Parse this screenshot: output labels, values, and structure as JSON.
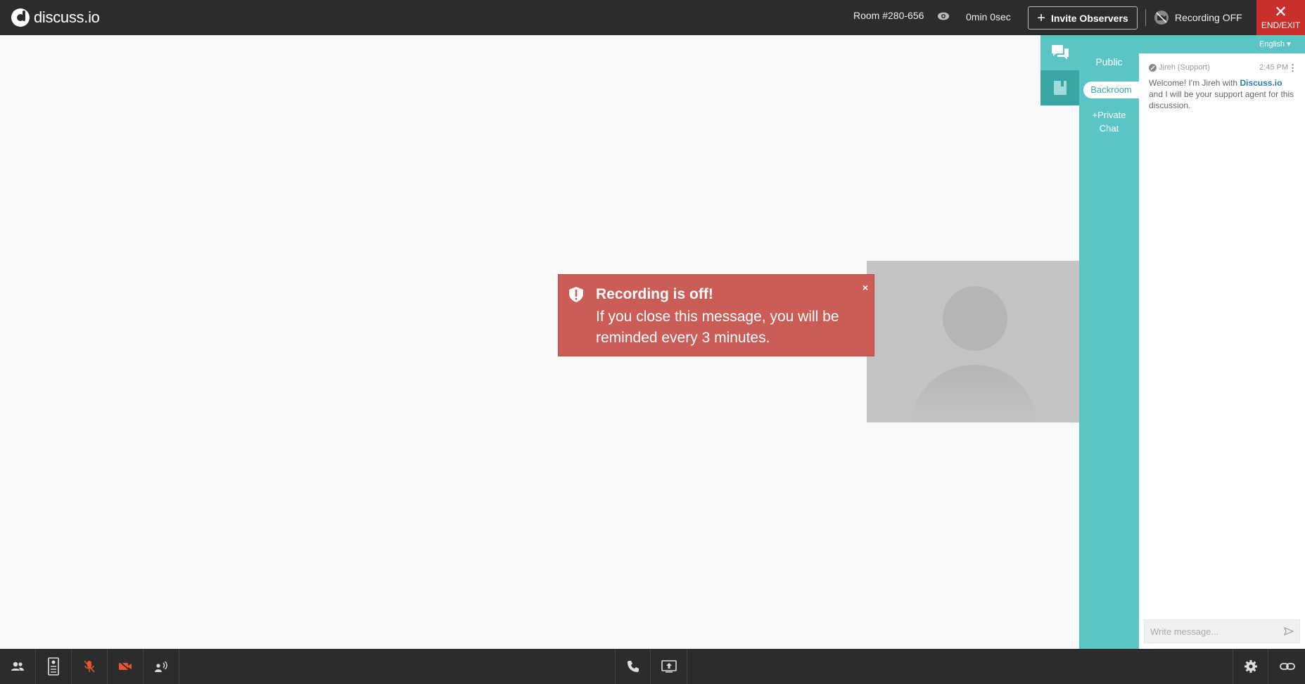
{
  "app": {
    "logo_text": "discuss.io"
  },
  "header": {
    "room": "Room #280-656",
    "timer": "0min 0sec",
    "invite_label": "Invite Observers",
    "recording_status": "Recording OFF",
    "end_label": "END/EXIT"
  },
  "sidebar": {
    "language": "English",
    "channels": {
      "public": "Public",
      "backroom": "Backroom",
      "private_line1": "Private",
      "private_line2": "Chat"
    }
  },
  "chat": {
    "messages": [
      {
        "author": "Jireh (Support)",
        "time": "2:45 PM",
        "text_before": "Welcome! I'm Jireh with ",
        "link": "Discuss.io",
        "text_after": " and I will be your support agent for this discussion."
      }
    ],
    "input_placeholder": "Write message..."
  },
  "alert": {
    "title": "Recording is off!",
    "text": "If you close this message, you will be reminded every 3 minutes.",
    "close": "×"
  },
  "colors": {
    "topbar": "#2c2c2c",
    "teal": "#5bc4c4",
    "teal_dark": "#3aa5a5",
    "alert": "#cc5c56",
    "end": "#c9302c",
    "muted_icon": "#e8552f"
  },
  "icons": {
    "bottom_left": [
      "participants-icon",
      "notes-icon",
      "mic-muted-icon",
      "camera-off-icon",
      "speaker-settings-icon"
    ],
    "bottom_center": [
      "phone-icon",
      "screen-share-icon"
    ],
    "bottom_right": [
      "settings-icon",
      "link-icon"
    ]
  }
}
